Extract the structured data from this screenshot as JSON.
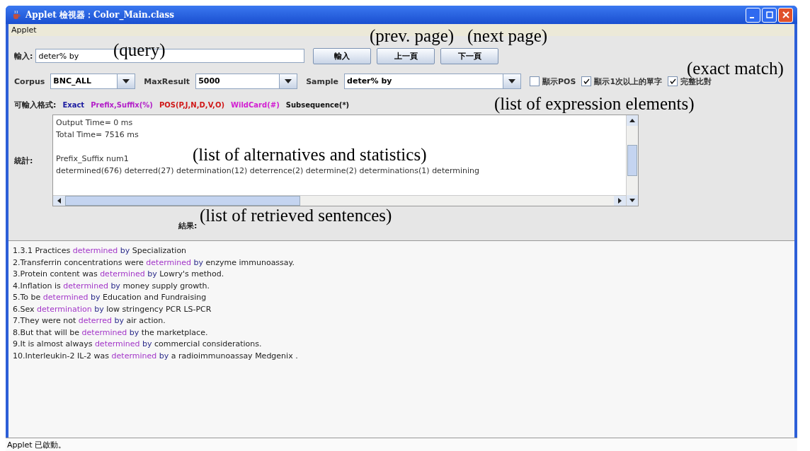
{
  "window": {
    "title": "Applet 檢視器：Color_Main.class"
  },
  "menu": [
    "Applet"
  ],
  "query": {
    "label": "輸入:",
    "value": "deter% by"
  },
  "buttons": [
    "輸入",
    "上一頁",
    "下一頁"
  ],
  "options": [
    {
      "kind": "dropdown",
      "label": "Corpus",
      "value": "BNC_ALL"
    },
    {
      "kind": "dropdown",
      "label": "MaxResult",
      "value": "5000"
    },
    {
      "kind": "dropdown",
      "label": "Sample",
      "value": "deter% by"
    },
    {
      "kind": "checkbox",
      "label": "顯示POS",
      "checked": false
    },
    {
      "kind": "checkbox",
      "label": "顯示1次以上的單字",
      "checked": true
    },
    {
      "kind": "checkbox",
      "label": "完整比對",
      "checked": true
    }
  ],
  "formats": {
    "label": "可輸入格式:",
    "items": [
      {
        "text": "Exact",
        "color": "#1a1aa0"
      },
      {
        "text": "Prefix,Suffix(%)",
        "color": "#b21fc8"
      },
      {
        "text": "POS(P,J,N,D,V,O)",
        "color": "#d01818"
      },
      {
        "text": "WildCard(#)",
        "color": "#d21ed2"
      },
      {
        "text": "Subsequence(*)",
        "color": "#111111"
      }
    ]
  },
  "statistics": {
    "label": "統計:",
    "groups": [
      [
        "Output Time= 0 ms",
        "Total Time= 7516 ms"
      ],
      [
        "Prefix_Suffix num1",
        "determined(676) deterred(27) determination(12) deterrence(2) determine(2) determinations(1) determining"
      ]
    ]
  },
  "results": {
    "label": "結果:",
    "sentences": [
      [
        {
          "kind": "plain",
          "text": "1.3.1 Practices "
        },
        {
          "kind": "match",
          "text": "determined"
        },
        {
          "kind": "keyword",
          "text": " by"
        },
        {
          "kind": "plain",
          "text": " Specialization"
        }
      ],
      [
        {
          "kind": "plain",
          "text": "2.Transferrin concentrations were "
        },
        {
          "kind": "match",
          "text": "determined"
        },
        {
          "kind": "keyword",
          "text": " by"
        },
        {
          "kind": "plain",
          "text": " enzyme immunoassay."
        }
      ],
      [
        {
          "kind": "plain",
          "text": "3.Protein content was "
        },
        {
          "kind": "match",
          "text": "determined"
        },
        {
          "kind": "keyword",
          "text": " by"
        },
        {
          "kind": "plain",
          "text": " Lowry's method."
        }
      ],
      [
        {
          "kind": "plain",
          "text": "4.Inflation is "
        },
        {
          "kind": "match",
          "text": "determined"
        },
        {
          "kind": "keyword",
          "text": " by"
        },
        {
          "kind": "plain",
          "text": " money supply growth."
        }
      ],
      [
        {
          "kind": "plain",
          "text": "5.To be "
        },
        {
          "kind": "match",
          "text": "determined"
        },
        {
          "kind": "keyword",
          "text": " by"
        },
        {
          "kind": "plain",
          "text": " Education and Fundraising"
        }
      ],
      [
        {
          "kind": "plain",
          "text": "6.Sex "
        },
        {
          "kind": "match",
          "text": "determination"
        },
        {
          "kind": "keyword",
          "text": " by"
        },
        {
          "kind": "plain",
          "text": " low stringency PCR  LS-PCR"
        }
      ],
      [
        {
          "kind": "plain",
          "text": "7.They were not "
        },
        {
          "kind": "match",
          "text": "deterred"
        },
        {
          "kind": "keyword",
          "text": " by"
        },
        {
          "kind": "plain",
          "text": " air action."
        }
      ],
      [
        {
          "kind": "plain",
          "text": "8.But that will be "
        },
        {
          "kind": "match",
          "text": "determined"
        },
        {
          "kind": "keyword",
          "text": " by"
        },
        {
          "kind": "plain",
          "text": " the marketplace."
        }
      ],
      [
        {
          "kind": "plain",
          "text": "9.It is almost always "
        },
        {
          "kind": "match",
          "text": "determined"
        },
        {
          "kind": "keyword",
          "text": " by"
        },
        {
          "kind": "plain",
          "text": " commercial considerations."
        }
      ],
      [
        {
          "kind": "plain",
          "text": "10.Interleukin-2  IL-2  was "
        },
        {
          "kind": "match",
          "text": "determined"
        },
        {
          "kind": "keyword",
          "text": " by"
        },
        {
          "kind": "plain",
          "text": " a radioimmunoassay  Medgenix ."
        }
      ]
    ]
  },
  "status_bar": "Applet 已啟動。",
  "annotations": [
    "(query)",
    "(prev. page)",
    "(next page)",
    "(exact match)",
    "(list of expression elements)",
    "(list of alternatives and statistics)",
    "(list of retrieved sentences)"
  ]
}
